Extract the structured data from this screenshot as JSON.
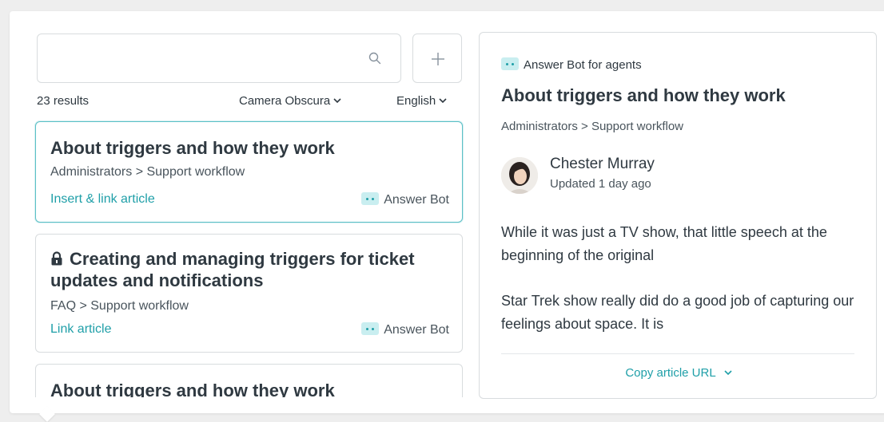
{
  "search": {
    "value": "",
    "placeholder": ""
  },
  "results": {
    "count_label": "23 results",
    "brand_filter": "Camera Obscura",
    "language_filter": "English"
  },
  "articles": [
    {
      "title": "About triggers and how they work",
      "breadcrumb": "Administrators  >  Support workflow",
      "action": "Insert & link article",
      "source": "Answer Bot"
    },
    {
      "title": "Creating and managing triggers for ticket updates and notifications",
      "breadcrumb": "FAQ  >  Support workflow",
      "action": "Link article",
      "source": "Answer Bot"
    },
    {
      "title": "About triggers and how they work"
    }
  ],
  "preview": {
    "source": "Answer Bot for agents",
    "title": "About triggers and how they work",
    "breadcrumb": "Administrators  >  Support workflow",
    "author": "Chester Murray",
    "updated": "Updated 1 day ago",
    "paragraphs": [
      "While it was just a TV show, that little speech at the beginning of the original",
      "Star Trek show really did do a good job of capturing our feelings about space. It is"
    ],
    "copy_label": "Copy article URL"
  },
  "colors": {
    "accent": "#1f9fa8",
    "selected_border": "#5cc0c6",
    "badge_bg": "#c9eef0"
  },
  "icons": {
    "search": "search-icon",
    "add": "plus-icon",
    "lock": "lock-icon",
    "bot": "answer-bot-icon",
    "chevron": "chevron-down-icon"
  }
}
